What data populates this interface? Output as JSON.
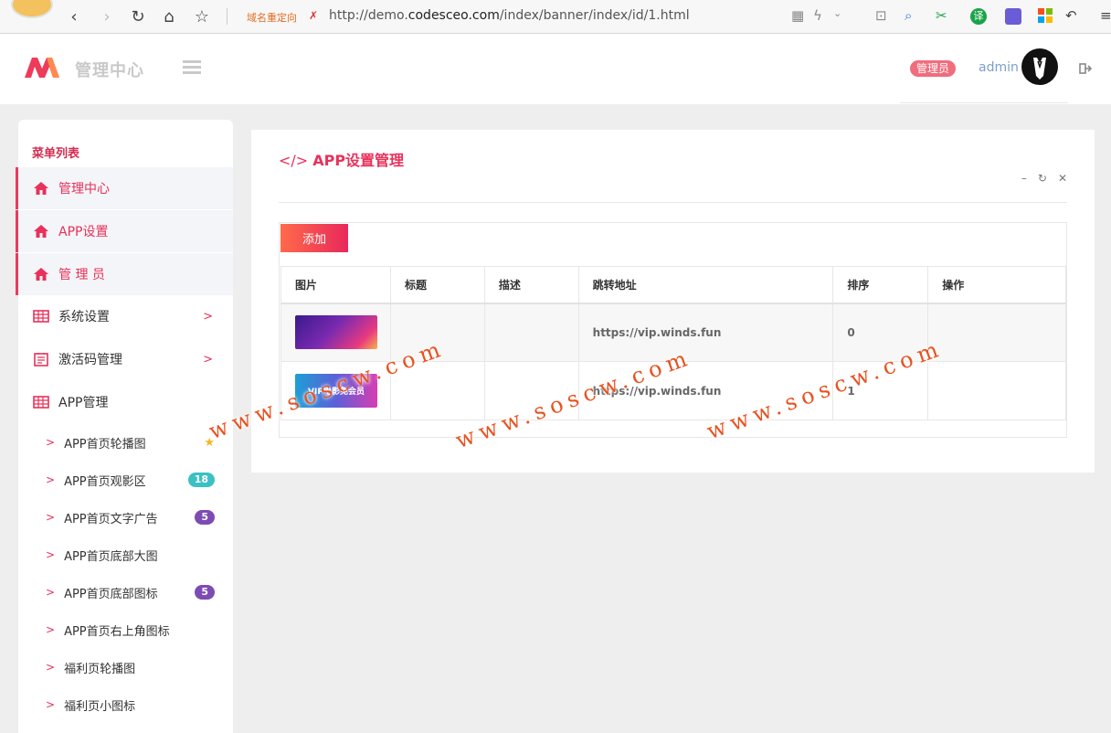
{
  "browser": {
    "redirect_label": "域名重定向",
    "url_prefix": "http://demo.",
    "url_host": "codesceo.com",
    "url_path": "/index/banner/index/id/1.html"
  },
  "header": {
    "title": "管理中心",
    "role_badge": "管理员",
    "username": "admin"
  },
  "sidebar": {
    "heading": "菜单列表",
    "items": [
      {
        "label": "管理中心",
        "icon": "home-icon",
        "active": true
      },
      {
        "label": "APP设置",
        "icon": "home-icon",
        "active": true
      },
      {
        "label": "管 理 员",
        "icon": "home-icon",
        "active": true
      },
      {
        "label": "系统设置",
        "icon": "table-icon",
        "arrow": ">"
      },
      {
        "label": "激活码管理",
        "icon": "list-icon",
        "arrow": ">"
      },
      {
        "label": "APP管理",
        "icon": "table-icon"
      }
    ],
    "sub_items": [
      {
        "label": "APP首页轮播图",
        "badge": ""
      },
      {
        "label": "APP首页观影区",
        "badge": "18"
      },
      {
        "label": "APP首页文字广告",
        "badge": "5"
      },
      {
        "label": "APP首页底部大图",
        "badge": ""
      },
      {
        "label": "APP首页底部图标",
        "badge": "5"
      },
      {
        "label": "APP首页右上角图标",
        "badge": ""
      },
      {
        "label": "福利页轮播图",
        "badge": ""
      },
      {
        "label": "福利页小图标",
        "badge": ""
      }
    ]
  },
  "panel": {
    "title_code": "</>",
    "title": "APP设置管理",
    "add_button": "添加",
    "columns": [
      "图片",
      "标题",
      "描述",
      "跳转地址",
      "排序",
      "操作"
    ],
    "rows": [
      {
        "title": "",
        "desc": "",
        "url": "https://vip.winds.fun",
        "sort": "0",
        "thumb_text": ""
      },
      {
        "title": "",
        "desc": "",
        "url": "https://vip.winds.fun",
        "sort": "1",
        "thumb_text": "VIP电影免会员"
      }
    ]
  },
  "watermark": "www.soscw.com",
  "colors": {
    "accent": "#e8315b",
    "badge_teal": "#3bc0c3",
    "badge_purple": "#7c4cb4",
    "watermark": "#e8521f"
  }
}
